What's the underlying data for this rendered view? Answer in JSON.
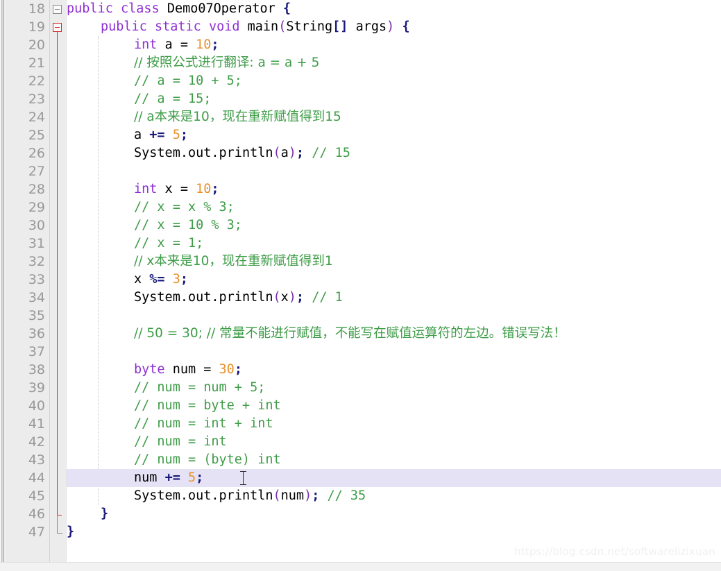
{
  "editor": {
    "language": "Java",
    "first_line_number": 18,
    "highlighted_line": 44,
    "colors": {
      "keyword": "#8f2fd4",
      "number": "#e8912c",
      "comment": "#3e9c47",
      "brace": "#181878",
      "paren": "#7a2fa8",
      "operator": "#181878",
      "gutter_bg": "#ececec",
      "line_number": "#999999",
      "current_line_bg": "#e6e2f5",
      "fold_active": "#d03030",
      "fold_inactive": "#8a8a8a",
      "editor_bg": "#ffffff"
    },
    "watermark": "https://blog.csdn.net/softwarelizixuan",
    "lines": [
      {
        "n": "18",
        "indent": 0,
        "fold": "gray",
        "tokens": [
          {
            "t": "public",
            "c": "kw"
          },
          {
            "t": " ",
            "c": "id"
          },
          {
            "t": "class",
            "c": "kw"
          },
          {
            "t": " ",
            "c": "id"
          },
          {
            "t": "Demo07Operator",
            "c": "id"
          },
          {
            "t": " ",
            "c": "id"
          },
          {
            "t": "{",
            "c": "br"
          }
        ]
      },
      {
        "n": "19",
        "indent": 1,
        "fold": "red",
        "tokens": [
          {
            "t": "public",
            "c": "kw"
          },
          {
            "t": " ",
            "c": "id"
          },
          {
            "t": "static",
            "c": "kw"
          },
          {
            "t": " ",
            "c": "id"
          },
          {
            "t": "void",
            "c": "kw"
          },
          {
            "t": " ",
            "c": "id"
          },
          {
            "t": "main",
            "c": "id"
          },
          {
            "t": "(",
            "c": "pa"
          },
          {
            "t": "String",
            "c": "id"
          },
          {
            "t": "[]",
            "c": "br"
          },
          {
            "t": " args",
            "c": "id"
          },
          {
            "t": ")",
            "c": "pa"
          },
          {
            "t": " ",
            "c": "id"
          },
          {
            "t": "{",
            "c": "br"
          }
        ]
      },
      {
        "n": "20",
        "indent": 2,
        "fold": "",
        "tokens": [
          {
            "t": "int",
            "c": "kw"
          },
          {
            "t": " a ",
            "c": "id"
          },
          {
            "t": "=",
            "c": "id"
          },
          {
            "t": " ",
            "c": "id"
          },
          {
            "t": "10",
            "c": "num"
          },
          {
            "t": ";",
            "c": "op"
          }
        ]
      },
      {
        "n": "21",
        "indent": 2,
        "fold": "",
        "tokens": [
          {
            "t": "// 按照公式进行翻译: a = a + 5",
            "c": "cmt"
          }
        ]
      },
      {
        "n": "22",
        "indent": 2,
        "fold": "",
        "tokens": [
          {
            "t": "// a = 10 + 5;",
            "c": "cmt"
          }
        ]
      },
      {
        "n": "23",
        "indent": 2,
        "fold": "",
        "tokens": [
          {
            "t": "// a = 15;",
            "c": "cmt"
          }
        ]
      },
      {
        "n": "24",
        "indent": 2,
        "fold": "",
        "tokens": [
          {
            "t": "// a本来是10，现在重新赋值得到15",
            "c": "cmt"
          }
        ]
      },
      {
        "n": "25",
        "indent": 2,
        "fold": "",
        "tokens": [
          {
            "t": "a ",
            "c": "id"
          },
          {
            "t": "+=",
            "c": "op"
          },
          {
            "t": " ",
            "c": "id"
          },
          {
            "t": "5",
            "c": "num"
          },
          {
            "t": ";",
            "c": "op"
          }
        ]
      },
      {
        "n": "26",
        "indent": 2,
        "fold": "",
        "tokens": [
          {
            "t": "System",
            "c": "id"
          },
          {
            "t": ".",
            "c": "id"
          },
          {
            "t": "out",
            "c": "id"
          },
          {
            "t": ".",
            "c": "id"
          },
          {
            "t": "println",
            "c": "id"
          },
          {
            "t": "(",
            "c": "pa"
          },
          {
            "t": "a",
            "c": "id"
          },
          {
            "t": ")",
            "c": "pa"
          },
          {
            "t": ";",
            "c": "op"
          },
          {
            "t": " ",
            "c": "id"
          },
          {
            "t": "// 15",
            "c": "cmt"
          }
        ]
      },
      {
        "n": "27",
        "indent": 2,
        "fold": "",
        "tokens": []
      },
      {
        "n": "28",
        "indent": 2,
        "fold": "",
        "tokens": [
          {
            "t": "int",
            "c": "kw"
          },
          {
            "t": " x ",
            "c": "id"
          },
          {
            "t": "=",
            "c": "id"
          },
          {
            "t": " ",
            "c": "id"
          },
          {
            "t": "10",
            "c": "num"
          },
          {
            "t": ";",
            "c": "op"
          }
        ]
      },
      {
        "n": "29",
        "indent": 2,
        "fold": "",
        "tokens": [
          {
            "t": "// x = x % 3;",
            "c": "cmt"
          }
        ]
      },
      {
        "n": "30",
        "indent": 2,
        "fold": "",
        "tokens": [
          {
            "t": "// x = 10 % 3;",
            "c": "cmt"
          }
        ]
      },
      {
        "n": "31",
        "indent": 2,
        "fold": "",
        "tokens": [
          {
            "t": "// x = 1;",
            "c": "cmt"
          }
        ]
      },
      {
        "n": "32",
        "indent": 2,
        "fold": "",
        "tokens": [
          {
            "t": "// x本来是10，现在重新赋值得到1",
            "c": "cmt"
          }
        ]
      },
      {
        "n": "33",
        "indent": 2,
        "fold": "",
        "tokens": [
          {
            "t": "x ",
            "c": "id"
          },
          {
            "t": "%=",
            "c": "op"
          },
          {
            "t": " ",
            "c": "id"
          },
          {
            "t": "3",
            "c": "num"
          },
          {
            "t": ";",
            "c": "op"
          }
        ]
      },
      {
        "n": "34",
        "indent": 2,
        "fold": "",
        "tokens": [
          {
            "t": "System",
            "c": "id"
          },
          {
            "t": ".",
            "c": "id"
          },
          {
            "t": "out",
            "c": "id"
          },
          {
            "t": ".",
            "c": "id"
          },
          {
            "t": "println",
            "c": "id"
          },
          {
            "t": "(",
            "c": "pa"
          },
          {
            "t": "x",
            "c": "id"
          },
          {
            "t": ")",
            "c": "pa"
          },
          {
            "t": ";",
            "c": "op"
          },
          {
            "t": " ",
            "c": "id"
          },
          {
            "t": "// 1",
            "c": "cmt"
          }
        ]
      },
      {
        "n": "35",
        "indent": 2,
        "fold": "",
        "tokens": []
      },
      {
        "n": "36",
        "indent": 2,
        "fold": "",
        "tokens": [
          {
            "t": "// 50 = 30; // 常量不能进行赋值，不能写在赋值运算符的左边。错误写法！",
            "c": "cmt"
          }
        ]
      },
      {
        "n": "37",
        "indent": 2,
        "fold": "",
        "tokens": []
      },
      {
        "n": "38",
        "indent": 2,
        "fold": "",
        "tokens": [
          {
            "t": "byte",
            "c": "kw"
          },
          {
            "t": " num ",
            "c": "id"
          },
          {
            "t": "=",
            "c": "id"
          },
          {
            "t": " ",
            "c": "id"
          },
          {
            "t": "30",
            "c": "num"
          },
          {
            "t": ";",
            "c": "op"
          }
        ]
      },
      {
        "n": "39",
        "indent": 2,
        "fold": "",
        "tokens": [
          {
            "t": "// num = num + 5;",
            "c": "cmt"
          }
        ]
      },
      {
        "n": "40",
        "indent": 2,
        "fold": "",
        "tokens": [
          {
            "t": "// num = byte + int",
            "c": "cmt"
          }
        ]
      },
      {
        "n": "41",
        "indent": 2,
        "fold": "",
        "tokens": [
          {
            "t": "// num = int + int",
            "c": "cmt"
          }
        ]
      },
      {
        "n": "42",
        "indent": 2,
        "fold": "",
        "tokens": [
          {
            "t": "// num = int",
            "c": "cmt"
          }
        ]
      },
      {
        "n": "43",
        "indent": 2,
        "fold": "",
        "tokens": [
          {
            "t": "// num = (byte) int",
            "c": "cmt"
          }
        ]
      },
      {
        "n": "44",
        "indent": 2,
        "fold": "",
        "tokens": [
          {
            "t": "num ",
            "c": "id"
          },
          {
            "t": "+=",
            "c": "op"
          },
          {
            "t": " ",
            "c": "id"
          },
          {
            "t": "5",
            "c": "num"
          },
          {
            "t": ";",
            "c": "op"
          }
        ]
      },
      {
        "n": "45",
        "indent": 2,
        "fold": "",
        "tokens": [
          {
            "t": "System",
            "c": "id"
          },
          {
            "t": ".",
            "c": "id"
          },
          {
            "t": "out",
            "c": "id"
          },
          {
            "t": ".",
            "c": "id"
          },
          {
            "t": "println",
            "c": "id"
          },
          {
            "t": "(",
            "c": "pa"
          },
          {
            "t": "num",
            "c": "id"
          },
          {
            "t": ")",
            "c": "pa"
          },
          {
            "t": ";",
            "c": "op"
          },
          {
            "t": " ",
            "c": "id"
          },
          {
            "t": "// 35",
            "c": "cmt"
          }
        ]
      },
      {
        "n": "46",
        "indent": 1,
        "fold": "",
        "tokens": [
          {
            "t": "}",
            "c": "br"
          }
        ]
      },
      {
        "n": "47",
        "indent": 0,
        "fold": "",
        "tokens": [
          {
            "t": "}",
            "c": "br"
          }
        ]
      }
    ]
  }
}
